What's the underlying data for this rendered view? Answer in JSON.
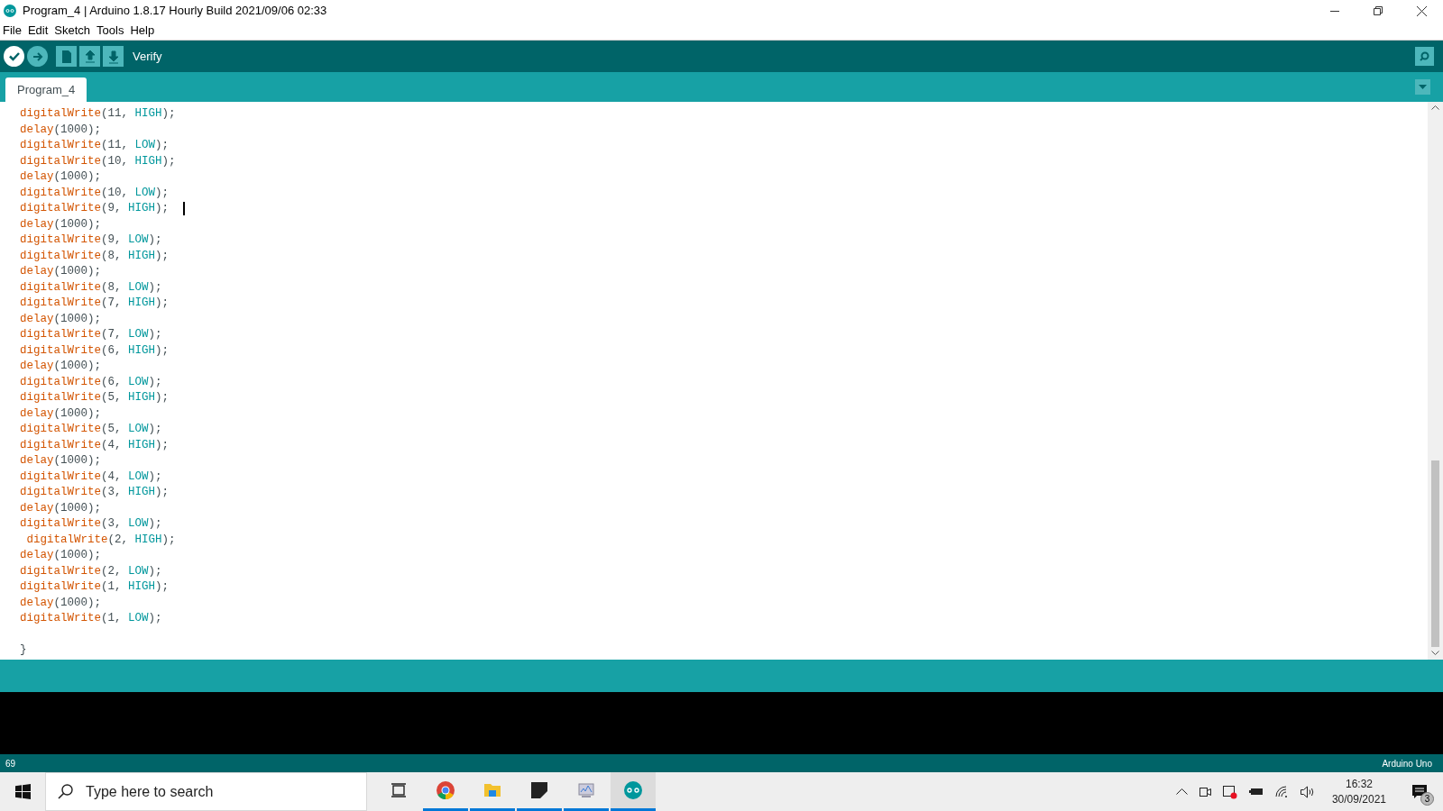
{
  "window": {
    "title": "Program_4 | Arduino 1.8.17 Hourly Build 2021/09/06 02:33"
  },
  "menu": [
    "File",
    "Edit",
    "Sketch",
    "Tools",
    "Help"
  ],
  "toolbar": {
    "buttons": [
      {
        "kind": "verify",
        "selected": true
      },
      {
        "kind": "upload",
        "selected": false
      },
      {
        "kind": "new",
        "selected": false
      },
      {
        "kind": "open",
        "selected": false
      },
      {
        "kind": "save",
        "selected": false
      }
    ],
    "hint": "Verify"
  },
  "tabs": [
    {
      "label": "Program_4",
      "selected": true
    }
  ],
  "editor": {
    "lines": [
      {
        "caret": false,
        "tokens": [
          {
            "kind": "func",
            "text": "digitalWrite"
          },
          {
            "kind": "plain",
            "text": "(11, "
          },
          {
            "kind": "const",
            "text": "HIGH"
          },
          {
            "kind": "plain",
            "text": ");"
          }
        ]
      },
      {
        "caret": false,
        "tokens": [
          {
            "kind": "func",
            "text": "delay"
          },
          {
            "kind": "plain",
            "text": "(1000);"
          }
        ]
      },
      {
        "caret": false,
        "tokens": [
          {
            "kind": "func",
            "text": "digitalWrite"
          },
          {
            "kind": "plain",
            "text": "(11, "
          },
          {
            "kind": "const",
            "text": "LOW"
          },
          {
            "kind": "plain",
            "text": ");"
          }
        ]
      },
      {
        "caret": false,
        "tokens": [
          {
            "kind": "func",
            "text": "digitalWrite"
          },
          {
            "kind": "plain",
            "text": "(10, "
          },
          {
            "kind": "const",
            "text": "HIGH"
          },
          {
            "kind": "plain",
            "text": ");"
          }
        ]
      },
      {
        "caret": false,
        "tokens": [
          {
            "kind": "func",
            "text": "delay"
          },
          {
            "kind": "plain",
            "text": "(1000);"
          }
        ]
      },
      {
        "caret": false,
        "tokens": [
          {
            "kind": "func",
            "text": "digitalWrite"
          },
          {
            "kind": "plain",
            "text": "(10, "
          },
          {
            "kind": "const",
            "text": "LOW"
          },
          {
            "kind": "plain",
            "text": ");"
          }
        ]
      },
      {
        "caret": true,
        "tokens": [
          {
            "kind": "func",
            "text": "digitalWrite"
          },
          {
            "kind": "plain",
            "text": "(9, "
          },
          {
            "kind": "const",
            "text": "HIGH"
          },
          {
            "kind": "plain",
            "text": ");"
          }
        ]
      },
      {
        "caret": false,
        "tokens": [
          {
            "kind": "func",
            "text": "delay"
          },
          {
            "kind": "plain",
            "text": "(1000);"
          }
        ]
      },
      {
        "caret": false,
        "tokens": [
          {
            "kind": "func",
            "text": "digitalWrite"
          },
          {
            "kind": "plain",
            "text": "(9, "
          },
          {
            "kind": "const",
            "text": "LOW"
          },
          {
            "kind": "plain",
            "text": ");"
          }
        ]
      },
      {
        "caret": false,
        "tokens": [
          {
            "kind": "func",
            "text": "digitalWrite"
          },
          {
            "kind": "plain",
            "text": "(8, "
          },
          {
            "kind": "const",
            "text": "HIGH"
          },
          {
            "kind": "plain",
            "text": ");"
          }
        ]
      },
      {
        "caret": false,
        "tokens": [
          {
            "kind": "func",
            "text": "delay"
          },
          {
            "kind": "plain",
            "text": "(1000);"
          }
        ]
      },
      {
        "caret": false,
        "tokens": [
          {
            "kind": "func",
            "text": "digitalWrite"
          },
          {
            "kind": "plain",
            "text": "(8, "
          },
          {
            "kind": "const",
            "text": "LOW"
          },
          {
            "kind": "plain",
            "text": ");"
          }
        ]
      },
      {
        "caret": false,
        "tokens": [
          {
            "kind": "func",
            "text": "digitalWrite"
          },
          {
            "kind": "plain",
            "text": "(7, "
          },
          {
            "kind": "const",
            "text": "HIGH"
          },
          {
            "kind": "plain",
            "text": ");"
          }
        ]
      },
      {
        "caret": false,
        "tokens": [
          {
            "kind": "func",
            "text": "delay"
          },
          {
            "kind": "plain",
            "text": "(1000);"
          }
        ]
      },
      {
        "caret": false,
        "tokens": [
          {
            "kind": "func",
            "text": "digitalWrite"
          },
          {
            "kind": "plain",
            "text": "(7, "
          },
          {
            "kind": "const",
            "text": "LOW"
          },
          {
            "kind": "plain",
            "text": ");"
          }
        ]
      },
      {
        "caret": false,
        "tokens": [
          {
            "kind": "func",
            "text": "digitalWrite"
          },
          {
            "kind": "plain",
            "text": "(6, "
          },
          {
            "kind": "const",
            "text": "HIGH"
          },
          {
            "kind": "plain",
            "text": ");"
          }
        ]
      },
      {
        "caret": false,
        "tokens": [
          {
            "kind": "func",
            "text": "delay"
          },
          {
            "kind": "plain",
            "text": "(1000);"
          }
        ]
      },
      {
        "caret": false,
        "tokens": [
          {
            "kind": "func",
            "text": "digitalWrite"
          },
          {
            "kind": "plain",
            "text": "(6, "
          },
          {
            "kind": "const",
            "text": "LOW"
          },
          {
            "kind": "plain",
            "text": ");"
          }
        ]
      },
      {
        "caret": false,
        "tokens": [
          {
            "kind": "func",
            "text": "digitalWrite"
          },
          {
            "kind": "plain",
            "text": "(5, "
          },
          {
            "kind": "const",
            "text": "HIGH"
          },
          {
            "kind": "plain",
            "text": ");"
          }
        ]
      },
      {
        "caret": false,
        "tokens": [
          {
            "kind": "func",
            "text": "delay"
          },
          {
            "kind": "plain",
            "text": "(1000);"
          }
        ]
      },
      {
        "caret": false,
        "tokens": [
          {
            "kind": "func",
            "text": "digitalWrite"
          },
          {
            "kind": "plain",
            "text": "(5, "
          },
          {
            "kind": "const",
            "text": "LOW"
          },
          {
            "kind": "plain",
            "text": ");"
          }
        ]
      },
      {
        "caret": false,
        "tokens": [
          {
            "kind": "func",
            "text": "digitalWrite"
          },
          {
            "kind": "plain",
            "text": "(4, "
          },
          {
            "kind": "const",
            "text": "HIGH"
          },
          {
            "kind": "plain",
            "text": ");"
          }
        ]
      },
      {
        "caret": false,
        "tokens": [
          {
            "kind": "func",
            "text": "delay"
          },
          {
            "kind": "plain",
            "text": "(1000);"
          }
        ]
      },
      {
        "caret": false,
        "tokens": [
          {
            "kind": "func",
            "text": "digitalWrite"
          },
          {
            "kind": "plain",
            "text": "(4, "
          },
          {
            "kind": "const",
            "text": "LOW"
          },
          {
            "kind": "plain",
            "text": ");"
          }
        ]
      },
      {
        "caret": false,
        "tokens": [
          {
            "kind": "func",
            "text": "digitalWrite"
          },
          {
            "kind": "plain",
            "text": "(3, "
          },
          {
            "kind": "const",
            "text": "HIGH"
          },
          {
            "kind": "plain",
            "text": ");"
          }
        ]
      },
      {
        "caret": false,
        "tokens": [
          {
            "kind": "func",
            "text": "delay"
          },
          {
            "kind": "plain",
            "text": "(1000);"
          }
        ]
      },
      {
        "caret": false,
        "tokens": [
          {
            "kind": "func",
            "text": "digitalWrite"
          },
          {
            "kind": "plain",
            "text": "(3, "
          },
          {
            "kind": "const",
            "text": "LOW"
          },
          {
            "kind": "plain",
            "text": ");"
          }
        ]
      },
      {
        "caret": false,
        "tokens": [
          {
            "kind": "func",
            "text": " digitalWrite"
          },
          {
            "kind": "plain",
            "text": "(2, "
          },
          {
            "kind": "const",
            "text": "HIGH"
          },
          {
            "kind": "plain",
            "text": ");"
          }
        ]
      },
      {
        "caret": false,
        "tokens": [
          {
            "kind": "func",
            "text": "delay"
          },
          {
            "kind": "plain",
            "text": "(1000);"
          }
        ]
      },
      {
        "caret": false,
        "tokens": [
          {
            "kind": "func",
            "text": "digitalWrite"
          },
          {
            "kind": "plain",
            "text": "(2, "
          },
          {
            "kind": "const",
            "text": "LOW"
          },
          {
            "kind": "plain",
            "text": ");"
          }
        ]
      },
      {
        "caret": false,
        "tokens": [
          {
            "kind": "func",
            "text": "digitalWrite"
          },
          {
            "kind": "plain",
            "text": "(1, "
          },
          {
            "kind": "const",
            "text": "HIGH"
          },
          {
            "kind": "plain",
            "text": ");"
          }
        ]
      },
      {
        "caret": false,
        "tokens": [
          {
            "kind": "func",
            "text": "delay"
          },
          {
            "kind": "plain",
            "text": "(1000);"
          }
        ]
      },
      {
        "caret": false,
        "tokens": [
          {
            "kind": "func",
            "text": "digitalWrite"
          },
          {
            "kind": "plain",
            "text": "(1, "
          },
          {
            "kind": "const",
            "text": "LOW"
          },
          {
            "kind": "plain",
            "text": ");"
          }
        ]
      },
      {
        "caret": false
      },
      {
        "caret": false,
        "tokens": [
          {
            "kind": "plain",
            "text": "}"
          }
        ]
      }
    ],
    "scroll": {
      "level": 0.35
    }
  },
  "status_bar": {
    "line": "69",
    "board": "Arduino Uno"
  },
  "taskbar": {
    "search": {
      "placeholder": "Type here to search"
    },
    "apps": [
      {
        "kind": "taskview",
        "running": false,
        "selected": false
      },
      {
        "kind": "chrome",
        "running": true,
        "selected": false
      },
      {
        "kind": "explorer",
        "running": true,
        "selected": false
      },
      {
        "kind": "notes",
        "running": true,
        "selected": false
      },
      {
        "kind": "monitor",
        "running": true,
        "selected": false
      },
      {
        "kind": "arduino",
        "running": true,
        "selected": true
      }
    ],
    "time": "16:32",
    "date": "30/09/2021",
    "notifications": "3"
  }
}
